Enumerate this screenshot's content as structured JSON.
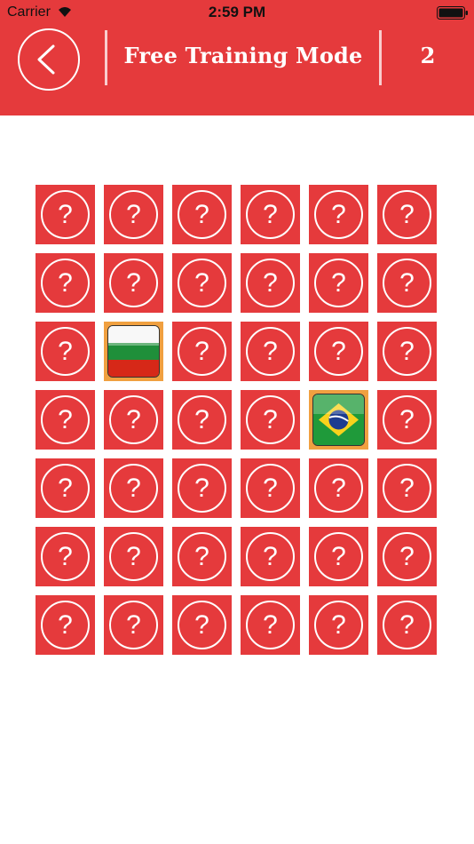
{
  "status_bar": {
    "carrier": "Carrier",
    "time": "2:59 PM"
  },
  "header": {
    "title": "Free Training Mode",
    "counter": "2"
  },
  "colors": {
    "accent": "#e53a3c",
    "revealed_card_bg": "#f0a040"
  },
  "board": {
    "rows": 7,
    "columns": 6,
    "hidden_symbol": "?",
    "revealed_cards": [
      {
        "row": 3,
        "column": 2,
        "flag": "bulgaria-flag"
      },
      {
        "row": 4,
        "column": 5,
        "flag": "brazil-flag"
      }
    ]
  }
}
